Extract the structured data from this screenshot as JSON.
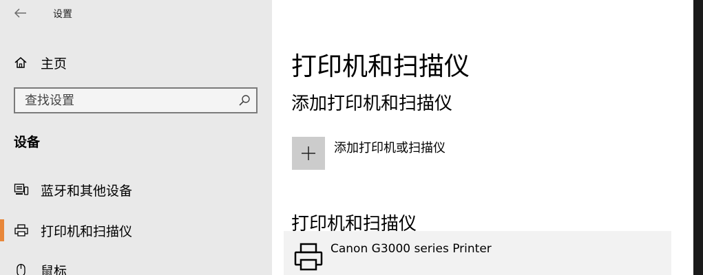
{
  "window": {
    "title": "设置",
    "back_icon": "back-arrow-icon"
  },
  "sidebar": {
    "home": {
      "label": "主页",
      "icon": "home-icon"
    },
    "search": {
      "placeholder": "查找设置",
      "icon": "search-icon"
    },
    "section_heading": "设备",
    "items": [
      {
        "label": "蓝牙和其他设备",
        "icon": "bluetooth-devices-icon",
        "selected": false
      },
      {
        "label": "打印机和扫描仪",
        "icon": "printer-icon",
        "selected": true
      },
      {
        "label": "鼠标",
        "icon": "mouse-icon",
        "selected": false
      }
    ],
    "accent_color": "#e8873a"
  },
  "main": {
    "title": "打印机和扫描仪",
    "add_section": {
      "heading": "添加打印机和扫描仪",
      "add_label": "添加打印机或扫描仪",
      "icon": "plus-icon"
    },
    "list_section": {
      "heading": "打印机和扫描仪",
      "printers": [
        {
          "name": "Canon G3000 series Printer",
          "icon": "printer-icon"
        }
      ]
    }
  }
}
